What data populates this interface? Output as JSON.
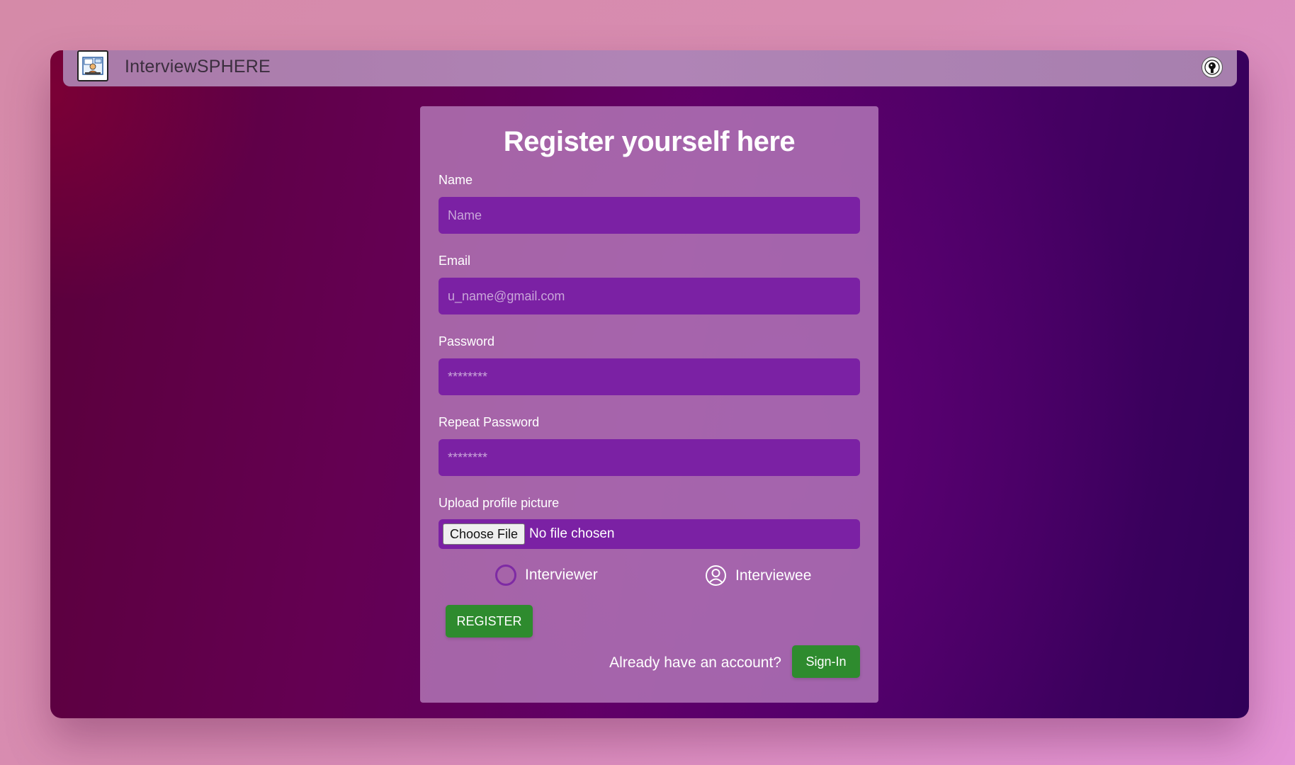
{
  "app": {
    "brand": "InterviewSPHERE"
  },
  "form": {
    "title": "Register yourself here",
    "fields": [
      {
        "label": "Name",
        "placeholder": "Name",
        "value": ""
      },
      {
        "label": "Email",
        "placeholder": "u_name@gmail.com",
        "value": ""
      },
      {
        "label": "Password",
        "placeholder": "********",
        "value": ""
      },
      {
        "label": "Repeat Password",
        "placeholder": "********",
        "value": ""
      }
    ],
    "upload": {
      "label": "Upload profile picture",
      "button": "Choose File",
      "status": "No file chosen"
    },
    "roles": [
      {
        "label": "Interviewer",
        "icon": "radio-circle-icon"
      },
      {
        "label": "Interviewee",
        "icon": "user-circle-icon"
      }
    ],
    "register_label": "REGISTER",
    "already_text": "Already have an account?",
    "signin_label": "Sign-In"
  },
  "colors": {
    "input_bg": "#7b21a4",
    "button_green": "#2e8b2e",
    "card_bg": "#b980be",
    "navbar_bg": "#b084b6"
  }
}
